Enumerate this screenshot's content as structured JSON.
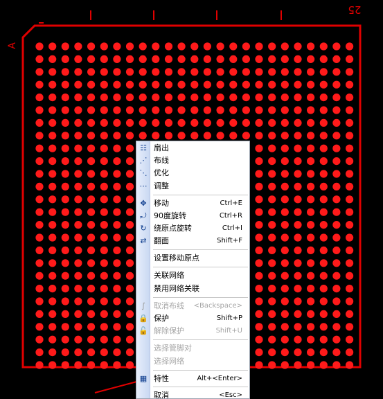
{
  "board": {
    "corner_number": "25",
    "corner_letter": "A",
    "pad_color": "#ff1a1a",
    "outline_color": "#e00000",
    "pad_rows": 26,
    "pad_cols": 25
  },
  "menu": {
    "items": [
      {
        "label": "扇出",
        "shortcut": "",
        "icon": "fanout-icon",
        "disabled": false
      },
      {
        "label": "布线",
        "shortcut": "",
        "icon": "route-icon",
        "disabled": false
      },
      {
        "label": "优化",
        "shortcut": "",
        "icon": "optimize-icon",
        "disabled": false
      },
      {
        "label": "调整",
        "shortcut": "",
        "icon": "adjust-icon",
        "disabled": false
      },
      {
        "label": "移动",
        "shortcut": "Ctrl+E",
        "icon": "move-icon",
        "disabled": false
      },
      {
        "label": "90度旋转",
        "shortcut": "Ctrl+R",
        "icon": "rotate-90-icon",
        "disabled": false
      },
      {
        "label": "绕原点旋转",
        "shortcut": "Ctrl+I",
        "icon": "rotate-origin-icon",
        "disabled": false
      },
      {
        "label": "翻面",
        "shortcut": "Shift+F",
        "icon": "flip-icon",
        "disabled": false
      },
      {
        "label": "设置移动原点",
        "shortcut": "",
        "icon": "",
        "disabled": false
      },
      {
        "label": "关联网络",
        "shortcut": "",
        "icon": "",
        "disabled": false
      },
      {
        "label": "禁用网络关联",
        "shortcut": "",
        "icon": "",
        "disabled": false
      },
      {
        "label": "取消布线",
        "shortcut": "<Backspace>",
        "icon": "unroute-icon",
        "disabled": true
      },
      {
        "label": "保护",
        "shortcut": "Shift+P",
        "icon": "lock-icon",
        "disabled": false
      },
      {
        "label": "解除保护",
        "shortcut": "Shift+U",
        "icon": "unlock-icon",
        "disabled": true
      },
      {
        "label": "选择管脚对",
        "shortcut": "",
        "icon": "",
        "disabled": true
      },
      {
        "label": "选择网络",
        "shortcut": "",
        "icon": "",
        "disabled": true
      },
      {
        "label": "特性",
        "shortcut": "Alt+<Enter>",
        "icon": "properties-icon",
        "disabled": false
      },
      {
        "label": "取消",
        "shortcut": "<Esc>",
        "icon": "",
        "disabled": false
      }
    ]
  }
}
